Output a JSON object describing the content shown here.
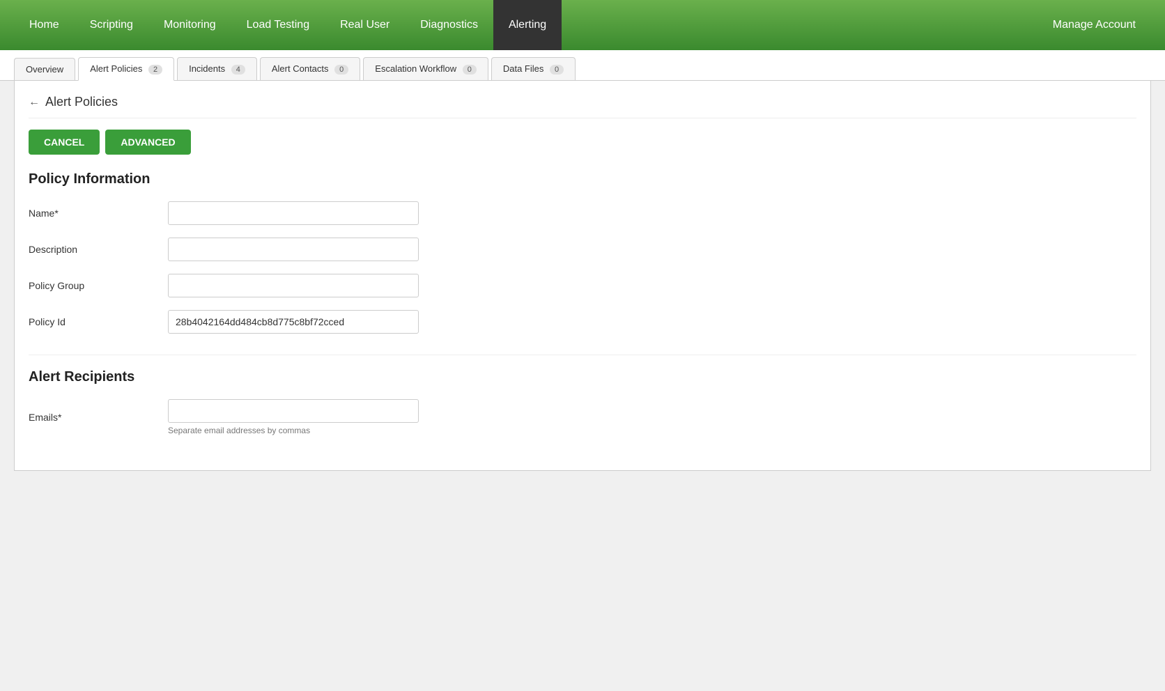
{
  "nav": {
    "items": [
      {
        "label": "Home",
        "active": false
      },
      {
        "label": "Scripting",
        "active": false
      },
      {
        "label": "Monitoring",
        "active": false
      },
      {
        "label": "Load Testing",
        "active": false
      },
      {
        "label": "Real User",
        "active": false
      },
      {
        "label": "Diagnostics",
        "active": false
      },
      {
        "label": "Alerting",
        "active": true
      }
    ],
    "manage_account": "Manage Account"
  },
  "tabs": [
    {
      "label": "Overview",
      "badge": null,
      "active": false
    },
    {
      "label": "Alert Policies",
      "badge": "2",
      "active": true
    },
    {
      "label": "Incidents",
      "badge": "4",
      "active": false
    },
    {
      "label": "Alert Contacts",
      "badge": "0",
      "active": false
    },
    {
      "label": "Escalation Workflow",
      "badge": "0",
      "active": false
    },
    {
      "label": "Data Files",
      "badge": "0",
      "active": false
    }
  ],
  "breadcrumb": {
    "arrow": "←",
    "title": "Alert Policies"
  },
  "buttons": {
    "cancel": "CANCEL",
    "advanced": "ADVANCED"
  },
  "policy_information": {
    "section_title": "Policy Information",
    "fields": [
      {
        "label": "Name*",
        "value": "",
        "placeholder": "",
        "id": "name",
        "readonly": false
      },
      {
        "label": "Description",
        "value": "",
        "placeholder": "",
        "id": "description",
        "readonly": false
      },
      {
        "label": "Policy Group",
        "value": "",
        "placeholder": "",
        "id": "policy-group",
        "readonly": false
      },
      {
        "label": "Policy Id",
        "value": "28b4042164dd484cb8d775c8bf72cced",
        "placeholder": "",
        "id": "policy-id",
        "readonly": true
      }
    ]
  },
  "alert_recipients": {
    "section_title": "Alert Recipients",
    "fields": [
      {
        "label": "Emails*",
        "value": "",
        "placeholder": "",
        "id": "emails",
        "hint": "Separate email addresses by commas",
        "readonly": false
      }
    ]
  }
}
